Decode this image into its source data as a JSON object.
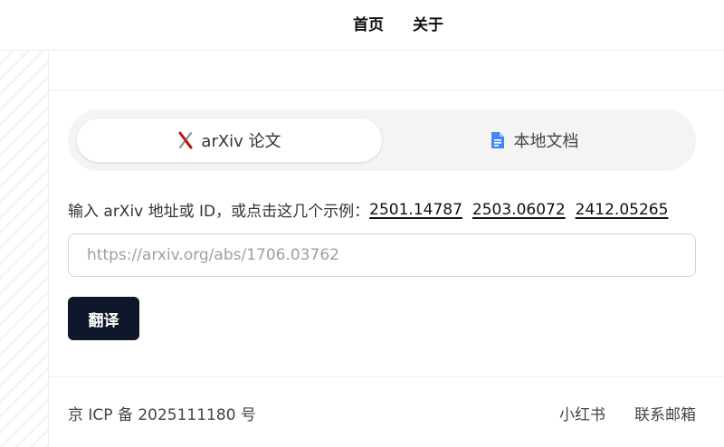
{
  "nav": {
    "home": "首页",
    "about": "关于"
  },
  "tabs": [
    {
      "label": "arXiv 论文",
      "icon": "arxiv-x-icon",
      "active": true
    },
    {
      "label": "本地文档",
      "icon": "document-icon",
      "active": false
    }
  ],
  "hint": {
    "text": "输入 arXiv 地址或 ID，或点击这几个示例：",
    "examples": [
      "2501.14787",
      "2503.06072",
      "2412.05265"
    ]
  },
  "input": {
    "placeholder": "https://arxiv.org/abs/1706.03762",
    "value": ""
  },
  "translate_button": "翻译",
  "footer": {
    "icp": "京 ICP 备 2025111180 号",
    "links": [
      "小红书",
      "联系邮箱"
    ]
  },
  "colors": {
    "button_bg": "#0f172a",
    "tabs_bg": "#f4f4f3",
    "doc_icon": "#4285f4",
    "arxiv_icon": "#b31b1b"
  }
}
